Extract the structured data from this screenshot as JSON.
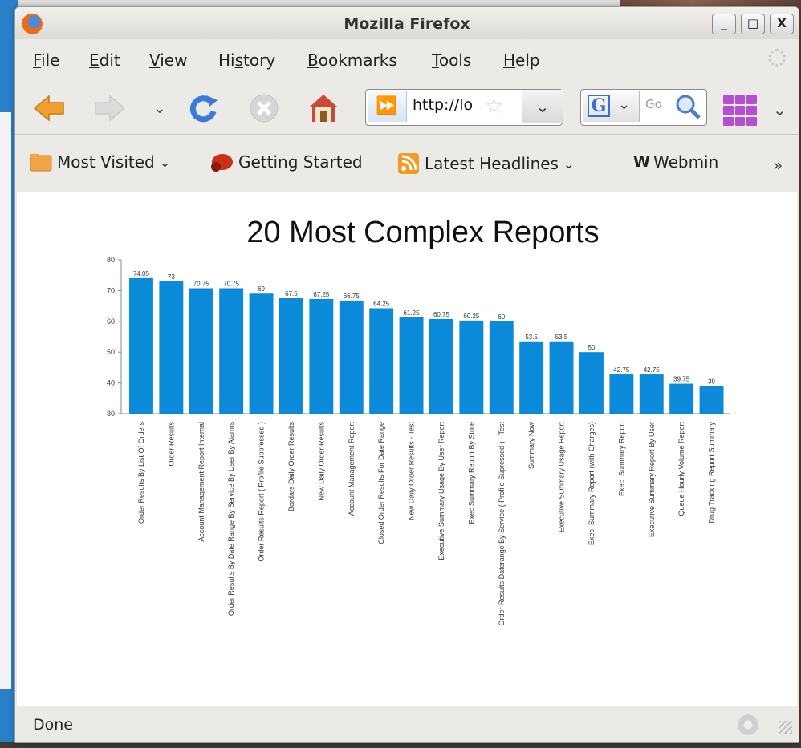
{
  "window": {
    "title": "Mozilla Firefox",
    "controls": [
      "_",
      "□",
      "X"
    ]
  },
  "menu": [
    {
      "label": "File",
      "ul": "F",
      "rest": "ile"
    },
    {
      "label": "Edit",
      "ul": "E",
      "rest": "dit"
    },
    {
      "label": "View",
      "ul": "V",
      "rest": "iew"
    },
    {
      "label": "History",
      "pre": "Hi",
      "ul": "s",
      "rest": "tory"
    },
    {
      "label": "Bookmarks",
      "ul": "B",
      "rest": "ookmarks"
    },
    {
      "label": "Tools",
      "ul": "T",
      "rest": "ools"
    },
    {
      "label": "Help",
      "ul": "H",
      "rest": "elp"
    }
  ],
  "nav": {
    "url": "http://lo",
    "search_placeholder": "Go"
  },
  "bookmarks": {
    "most_visited": "Most Visited",
    "getting_started": "Getting Started",
    "latest_headlines": "Latest Headlines",
    "webmin": "Webmin",
    "overflow": "»"
  },
  "status": {
    "text": "Done"
  },
  "colors": {
    "bar": "#0a8ad8"
  },
  "chart_data": {
    "type": "bar",
    "title": "20 Most Complex Reports",
    "ylim": [
      30,
      80
    ],
    "yticks": [
      30,
      40,
      50,
      60,
      70,
      80
    ],
    "categories": [
      "Order Results By List Of Orders",
      "Order Results",
      "Account Management Report Internal",
      "Order Results By Date Range By Service By User By Alarms",
      "Order Results Report ( Profile Suppressed )",
      "Bordars Daily Order Results",
      "New Daily Order Results",
      "Account Management Report",
      "Closed Order Results For Date Range",
      "New Daily Order Results - Test",
      "Executive Summary Usage By User Report",
      "Exec Summary Report By Store",
      "Order Results Daterange By Service ( Profile Supressed ) - Test",
      "Summary Now",
      "Executive Summary Usage Report",
      "Exec. Summary Report (with Charges)",
      "Exec. Summary Report",
      "Executive Summary Report By User",
      "Queue Hourly Volume Report",
      "Drug Tracking Report Summary"
    ],
    "values": [
      74.05,
      73,
      70.75,
      70.75,
      69,
      67.5,
      67.25,
      66.75,
      64.25,
      61.25,
      60.75,
      60.25,
      60,
      53.5,
      53.5,
      50,
      42.75,
      42.75,
      39.75,
      39
    ],
    "value_labels": [
      "74.05",
      "73",
      "70.75",
      "70.75",
      "69",
      "67.5",
      "67.25",
      "66.75",
      "64.25",
      "61.25",
      "60.75",
      "60.25",
      "60",
      "53.5",
      "53.5",
      "50",
      "42.75",
      "42.75",
      "39.75",
      "39"
    ],
    "grid": false,
    "legend": "none"
  }
}
